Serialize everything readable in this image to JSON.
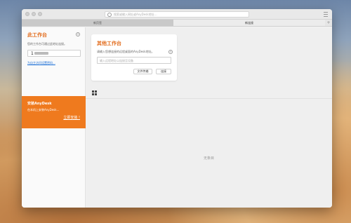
{
  "browser": {
    "address_placeholder": "搜索或输入网址或AnyDesk地址…",
    "tabs": [
      {
        "label": "新页签"
      },
      {
        "label": "新连接"
      }
    ],
    "new_tab_label": "+"
  },
  "sidebar": {
    "title": "此工作台",
    "description": "您的工作台可通过此地址连接。",
    "id_value": "1",
    "set_password_link": "为自主访问设置密码..."
  },
  "promo": {
    "title": "安装AnyDesk",
    "description": "在本机上安装AnyDesk...",
    "install_link": "立即安装 !"
  },
  "remote": {
    "title": "其他工作台",
    "description": "请输入您想连接的远程桌面的AnyDesk地址。",
    "input_placeholder": "输入远程地址以连接至设备",
    "file_transfer_label": "文件传输",
    "connect_label": "连接"
  },
  "recent": {
    "empty_text": "无条目"
  },
  "colors": {
    "accent": "#ef7a1e",
    "title_orange": "#e26b1b",
    "link_blue": "#1a6ed6"
  }
}
